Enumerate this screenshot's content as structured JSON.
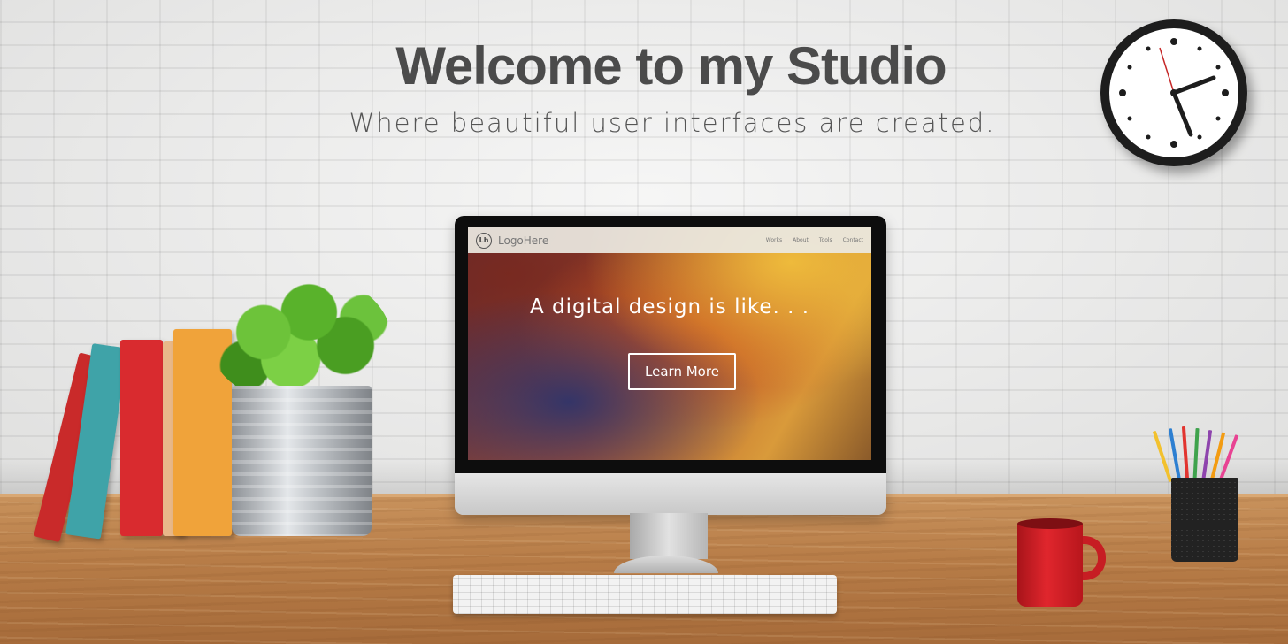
{
  "hero": {
    "title": "Welcome to my Studio",
    "subtitle": "Where beautiful user interfaces are created."
  },
  "clock": {
    "icon": "wall-clock-icon"
  },
  "monitor": {
    "site": {
      "logo_mark": "Lh",
      "logo_text": "LogoHere",
      "nav": [
        "Works",
        "About",
        "Tools",
        "Contact"
      ],
      "headline": "A digital design is like. . .",
      "cta_label": "Learn More"
    }
  },
  "colors": {
    "heading": "#4b4b4b",
    "wall": "#ebebea",
    "desk": "#b77c47",
    "books": [
      "#c92a2a",
      "#3fa3a8",
      "#d92b2f",
      "#e8b889",
      "#f0a33a"
    ],
    "mug": "#e0262d"
  }
}
